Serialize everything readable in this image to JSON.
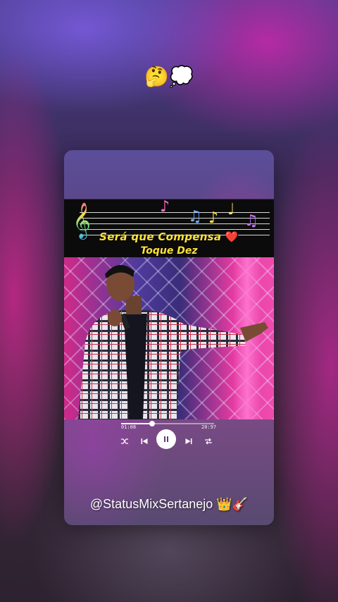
{
  "overlay": {
    "top_emoji": "🤔💭"
  },
  "banner": {
    "title": "Será que Compensa",
    "heart": "❤️",
    "artist": "Toque Dez",
    "clef": "𝄞",
    "notes": [
      "♪",
      "♫",
      "♪",
      "♩",
      "♫"
    ]
  },
  "player": {
    "elapsed": "01:08",
    "duration": "20:97",
    "progress": 0.33,
    "icons": [
      "shuffle-icon",
      "previous-icon",
      "pause-icon",
      "next-icon",
      "repeat-icon"
    ]
  },
  "footer": {
    "handle": "@StatusMixSertanejo 👑🎸"
  },
  "colors": {
    "title": "#ffe23a",
    "heart": "#ff2b3a",
    "banner_bg": "#0b0b0b"
  }
}
